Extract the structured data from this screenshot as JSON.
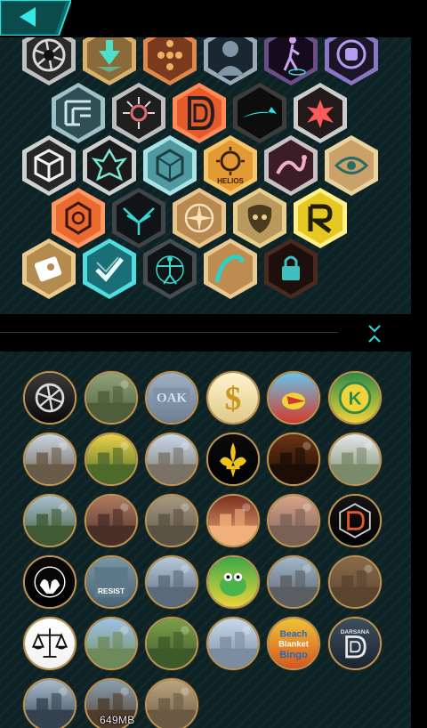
{
  "app": {
    "title": "",
    "back_icon": "back-arrow-icon",
    "accent": "#23c7c7"
  },
  "badges": [
    {
      "id": "aperture",
      "icon": "aperture-icon",
      "fill": "#2a2a2a",
      "stroke": "#bfbfbf",
      "glyph": "#d9d9d9"
    },
    {
      "id": "hero",
      "icon": "arrow-down-icon",
      "fill": "#8a6a3b",
      "stroke": "#d8b06a",
      "glyph": "#4ce0c8"
    },
    {
      "id": "dots",
      "icon": "dots-icon",
      "fill": "#7a3a1e",
      "stroke": "#e0884a",
      "glyph": "#f0b060"
    },
    {
      "id": "portrait",
      "icon": "portrait-icon",
      "fill": "#1b2730",
      "stroke": "#9aa9b5",
      "glyph": "#7f95a8"
    },
    {
      "id": "walker",
      "icon": "walker-icon",
      "fill": "#140c1c",
      "stroke": "#6a4e86",
      "glyph": "#c9a3f0"
    },
    {
      "id": "fist",
      "icon": "fist-icon",
      "fill": "#1a1628",
      "stroke": "#8a76c4",
      "glyph": "#b49df0"
    },
    {
      "id": "maze",
      "icon": "maze-icon",
      "fill": "#2f4f54",
      "stroke": "#9dc2c6",
      "glyph": "#cfe6e8"
    },
    {
      "id": "circuit",
      "icon": "circuit-icon",
      "fill": "#1f1f1f",
      "stroke": "#bdbdbd",
      "glyph": "#e36a6a"
    },
    {
      "id": "dlogo-orange",
      "icon": "d-logo-icon",
      "fill": "#e5592a",
      "stroke": "#ff8a57",
      "glyph": "#1f1f1f"
    },
    {
      "id": "shark",
      "icon": "shark-icon",
      "fill": "#0d0d0d",
      "stroke": "#3d3d3d",
      "glyph": "#2fe0e0"
    },
    {
      "id": "splatter",
      "icon": "splatter-icon",
      "fill": "#231a1a",
      "stroke": "#cccccc",
      "glyph": "#ff5a5a"
    },
    {
      "id": "cube",
      "icon": "cube-icon",
      "fill": "#262626",
      "stroke": "#d0d0d0",
      "glyph": "#f2f2f2"
    },
    {
      "id": "dragon",
      "icon": "dragon-icon",
      "fill": "#1a1a1a",
      "stroke": "#cfcfcf",
      "glyph": "#7ae6d6"
    },
    {
      "id": "gem",
      "icon": "gem-icon",
      "fill": "#4e9aa0",
      "stroke": "#a9e3e6",
      "glyph": "#1c3e42"
    },
    {
      "id": "helios",
      "icon": "helios-icon",
      "label": "HELIOS",
      "fill": "#e39a33",
      "stroke": "#f6c46a",
      "glyph": "#3a1f05"
    },
    {
      "id": "serpent",
      "icon": "serpent-icon",
      "fill": "#3b1d27",
      "stroke": "#c9c0c3",
      "glyph": "#f0b0c0"
    },
    {
      "id": "eye",
      "icon": "eye-icon",
      "fill": "#c9a26a",
      "stroke": "#ead39f",
      "glyph": "#2e6a64"
    },
    {
      "id": "flower",
      "icon": "flower-icon",
      "fill": "#e9692f",
      "stroke": "#ff9a66",
      "glyph": "#3a1406"
    },
    {
      "id": "wings",
      "icon": "wings-icon",
      "fill": "#101416",
      "stroke": "#3e4448",
      "glyph": "#38d6d6"
    },
    {
      "id": "compass",
      "icon": "compass-icon",
      "fill": "#b88950",
      "stroke": "#e6c48c",
      "glyph": "#f4e3c2"
    },
    {
      "id": "mask",
      "icon": "mask-icon",
      "fill": "#b9995c",
      "stroke": "#e8cf8e",
      "glyph": "#4a3a1e"
    },
    {
      "id": "glyph-yellow",
      "icon": "knot-icon",
      "fill": "#e6c823",
      "stroke": "#fff08a",
      "glyph": "#221e05"
    },
    {
      "id": "scroll",
      "icon": "scroll-icon",
      "fill": "#b48b4f",
      "stroke": "#e9c98c",
      "glyph": "#ffffff"
    },
    {
      "id": "check",
      "icon": "check-icon",
      "fill": "#1a6e77",
      "stroke": "#4fdde0",
      "glyph": "#e9ffff"
    },
    {
      "id": "vitruvian",
      "icon": "vitruvian-icon",
      "fill": "#101415",
      "stroke": "#454d50",
      "glyph": "#36d8d0"
    },
    {
      "id": "wave",
      "icon": "wave-icon",
      "fill": "#bd8c4e",
      "stroke": "#e9c992",
      "glyph": "#2fd0c8"
    },
    {
      "id": "lock",
      "icon": "lock-icon",
      "fill": "#1c0f0c",
      "stroke": "#4a2a1e",
      "glyph": "#3fc0c0"
    }
  ],
  "medals": [
    {
      "id": "m1",
      "icon": "aperture-medal-icon",
      "c1": "#3a3a3a",
      "c2": "#0a0a0a",
      "glyph": "#d9d9d9"
    },
    {
      "id": "m2",
      "icon": "oak-trees-photo",
      "c1": "#8fa37a",
      "c2": "#4e5e3a"
    },
    {
      "id": "m3",
      "icon": "oak-sign-photo",
      "label": "OAK",
      "c1": "#9fb0c3",
      "c2": "#6b7f93"
    },
    {
      "id": "m4",
      "icon": "dollar-sign-icon",
      "label": "$",
      "c1": "#fff4cc",
      "c2": "#e0c98a"
    },
    {
      "id": "m5",
      "icon": "pelican-icon",
      "c1": "#6ac3e8",
      "c2": "#d33a2c"
    },
    {
      "id": "m6",
      "icon": "city-of-kenner-seal",
      "label": "K",
      "c1": "#2f8a45",
      "c2": "#f0d23a"
    },
    {
      "id": "m7",
      "icon": "historic-marker-photo",
      "c1": "#c9d6e2",
      "c2": "#6a5a48"
    },
    {
      "id": "m8",
      "icon": "daffodils-duck-photo",
      "c1": "#e9d14a",
      "c2": "#4d6a2a"
    },
    {
      "id": "m9",
      "icon": "cathedral-photo",
      "c1": "#c8d8ea",
      "c2": "#7a7266"
    },
    {
      "id": "m10",
      "icon": "fleur-de-lis-icon",
      "c1": "#0b0b0b",
      "c2": "#000000",
      "glyph": "#f0c21c"
    },
    {
      "id": "m11",
      "icon": "beer-glasses-photo",
      "c1": "#6a3312",
      "c2": "#1c0d06"
    },
    {
      "id": "m12",
      "icon": "white-house-photo",
      "c1": "#e2e7ea",
      "c2": "#7b8a6a"
    },
    {
      "id": "m13",
      "icon": "mansion-photo",
      "c1": "#a8c0d0",
      "c2": "#3f5a34"
    },
    {
      "id": "m14",
      "icon": "crowd-photo",
      "c1": "#b07a62",
      "c2": "#4a2f28"
    },
    {
      "id": "m15",
      "icon": "storefront-photo",
      "c1": "#a79a82",
      "c2": "#5a5244"
    },
    {
      "id": "m16",
      "icon": "candle-photo",
      "c1": "#7a3020",
      "c2": "#f0b07a"
    },
    {
      "id": "m17",
      "icon": "city-skyline-photo",
      "c1": "#d9a489",
      "c2": "#7a6156"
    },
    {
      "id": "m18",
      "icon": "d-logo-medal-icon",
      "c1": "#151515",
      "c2": "#000000",
      "glyph": "#d0d0d0"
    },
    {
      "id": "m19",
      "icon": "hands-medal-icon",
      "c1": "#0a0a0a",
      "c2": "#000000",
      "glyph": "#ffffff"
    },
    {
      "id": "m20",
      "icon": "keep-calm-sign-photo",
      "label": "RESIST",
      "c1": "#7a96a6",
      "c2": "#4a6272"
    },
    {
      "id": "m21",
      "icon": "riverboat-photo",
      "c1": "#b5c9d8",
      "c2": "#5a6a7a"
    },
    {
      "id": "m22",
      "icon": "frog-cartoon-icon",
      "c1": "#3aa84a",
      "c2": "#f0d23a"
    },
    {
      "id": "m23",
      "icon": "downtown-photo",
      "c1": "#9fb7cc",
      "c2": "#5b5e62"
    },
    {
      "id": "m24",
      "icon": "door-photo",
      "c1": "#8a6a4a",
      "c2": "#5a4430"
    },
    {
      "id": "m25",
      "icon": "scales-of-justice-icon",
      "c1": "#ffffff",
      "c2": "#f2f2f2",
      "glyph": "#111111"
    },
    {
      "id": "m26",
      "icon": "lake-photo",
      "c1": "#9fc3e6",
      "c2": "#6f8a5a"
    },
    {
      "id": "m27",
      "icon": "garden-house-photo",
      "c1": "#7aa04a",
      "c2": "#3d5a2a"
    },
    {
      "id": "m28",
      "icon": "chapel-photo",
      "c1": "#c6d8ec",
      "c2": "#7d8da0"
    },
    {
      "id": "m29",
      "icon": "beach-blanket-bingo-sign",
      "label": "Beach Blanket Bingo",
      "c1": "#f0c23a",
      "c2": "#d8551e"
    },
    {
      "id": "m30",
      "icon": "darsana-logo-icon",
      "label": "DARSANA",
      "c1": "#3e4e5e",
      "c2": "#1a2430",
      "glyph": "#e8e8e8"
    },
    {
      "id": "m31",
      "icon": "marching-band-photo",
      "c1": "#a8bccf",
      "c2": "#33424e"
    },
    {
      "id": "m32",
      "icon": "parade-photo",
      "c1": "#8aa0b0",
      "c2": "#4e3c2c"
    },
    {
      "id": "m33",
      "icon": "balcony-building-photo",
      "c1": "#bca47e",
      "c2": "#6a5a44"
    }
  ],
  "status": {
    "memory": "649MB"
  },
  "controls": {
    "collapse_icon": "collapse-chevrons-icon"
  }
}
